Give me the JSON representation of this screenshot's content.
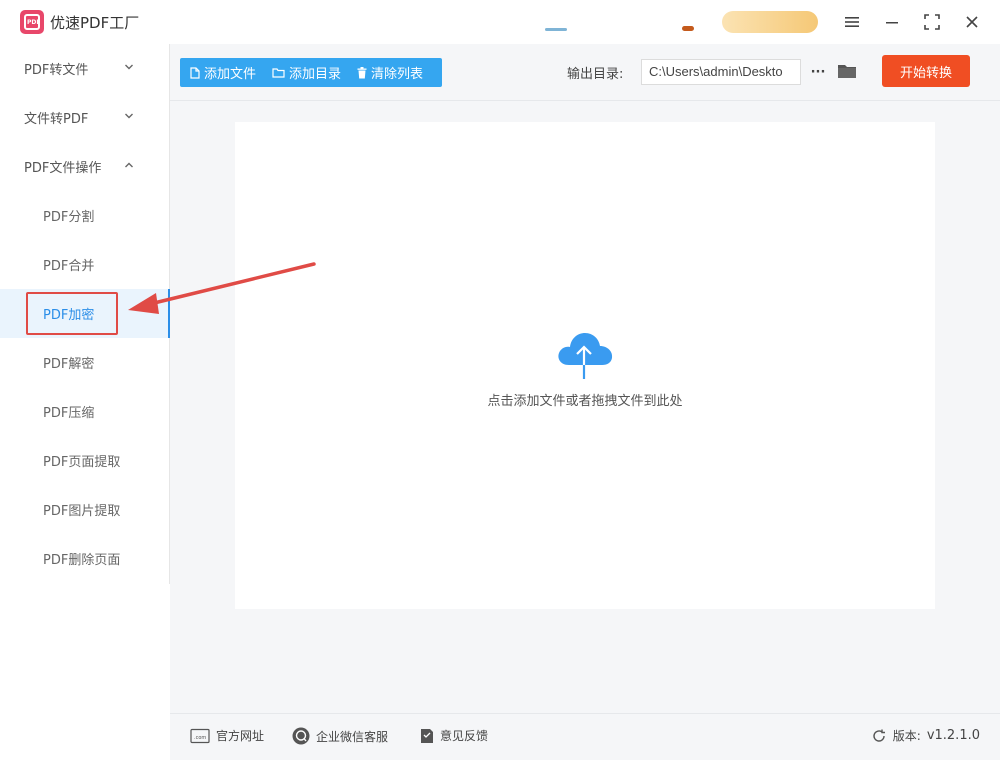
{
  "app": {
    "title": "优速PDF工厂",
    "logo_text": "PDF"
  },
  "sidebar": {
    "groups": [
      {
        "label": "PDF转文件",
        "expanded": false
      },
      {
        "label": "文件转PDF",
        "expanded": false
      },
      {
        "label": "PDF文件操作",
        "expanded": true
      }
    ],
    "items": [
      {
        "label": "PDF分割"
      },
      {
        "label": "PDF合并"
      },
      {
        "label": "PDF加密",
        "active": true
      },
      {
        "label": "PDF解密"
      },
      {
        "label": "PDF压缩"
      },
      {
        "label": "PDF页面提取"
      },
      {
        "label": "PDF图片提取"
      },
      {
        "label": "PDF删除页面"
      }
    ]
  },
  "toolbar": {
    "add_file": "添加文件",
    "add_folder": "添加目录",
    "clear_list": "清除列表",
    "output_label": "输出目录:",
    "output_path": "C:\\Users\\admin\\Deskto",
    "more": "···",
    "start": "开始转换"
  },
  "dropzone": {
    "text": "点击添加文件或者拖拽文件到此处"
  },
  "footer": {
    "website": "官方网址",
    "wechat": "企业微信客服",
    "feedback": "意见反馈",
    "version_label": "版本:",
    "version": "v1.2.1.0"
  },
  "colors": {
    "accent": "#2b8ee8",
    "toolbar_buttons": "#35a6f0",
    "start_button": "#f04e23",
    "annotation": "#e04b46",
    "cloud": "#3a9bf0"
  }
}
